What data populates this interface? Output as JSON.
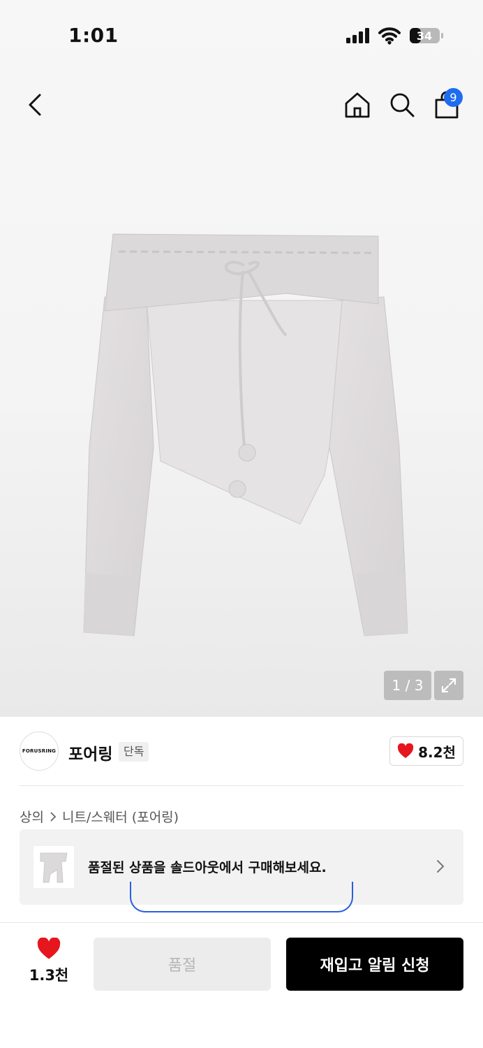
{
  "status_bar": {
    "time": "1:01",
    "battery": "34"
  },
  "header": {
    "cart_count": "9"
  },
  "gallery": {
    "pager": "1 / 3"
  },
  "brand": {
    "logo_text": "FORUSRING",
    "name": "포어링",
    "tag": "단독",
    "like_count": "8.2천"
  },
  "breadcrumb": {
    "items": [
      "상의",
      "니트/스웨터 (포어링)"
    ]
  },
  "soldout_banner": {
    "text": "품절된 상품을 솔드아웃에서 구매해보세요."
  },
  "bottom_bar": {
    "favorite_count": "1.3천",
    "soldout_label": "품절",
    "restock_label": "재입고 알림 신청"
  },
  "colors": {
    "accent_blue": "#1e6cf0",
    "heart_red": "#e5161e",
    "primary_black": "#000000"
  },
  "icons": [
    "back-icon",
    "home-icon",
    "search-icon",
    "shopping-bag-icon",
    "expand-icon",
    "heart-icon",
    "chevron-right-icon"
  ]
}
